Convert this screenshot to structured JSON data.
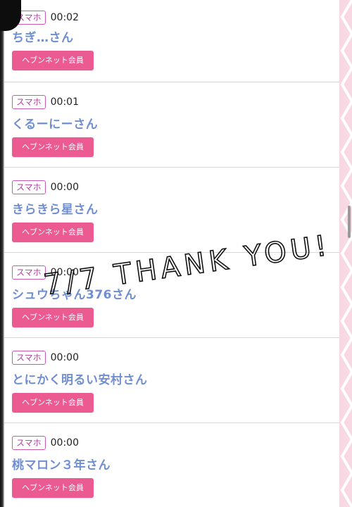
{
  "overlay": {
    "handwritten_text": "7/7 THANK YOU!"
  },
  "entries": [
    {
      "device": "スマホ",
      "time": "00:02",
      "name": "ちぎ…さん",
      "member_label": "ヘブンネット会員"
    },
    {
      "device": "スマホ",
      "time": "00:01",
      "name": "くるーにーさん",
      "member_label": "ヘブンネット会員"
    },
    {
      "device": "スマホ",
      "time": "00:00",
      "name": "きらきら星さん",
      "member_label": "ヘブンネット会員"
    },
    {
      "device": "スマホ",
      "time": "00:00",
      "name": "シュウちゃん376さん",
      "member_label": "ヘブンネット会員"
    },
    {
      "device": "スマホ",
      "time": "00:00",
      "name": "とにかく明るい安村さん",
      "member_label": "ヘブンネット会員"
    },
    {
      "device": "スマホ",
      "time": "00:00",
      "name": "桃マロン３年さん",
      "member_label": "ヘブンネット会員"
    }
  ],
  "colors": {
    "badge_border": "#c85ab3",
    "name_text": "#6f8fd2",
    "member_button": "#ec5a92",
    "side_panel": "#f8d9e3"
  }
}
